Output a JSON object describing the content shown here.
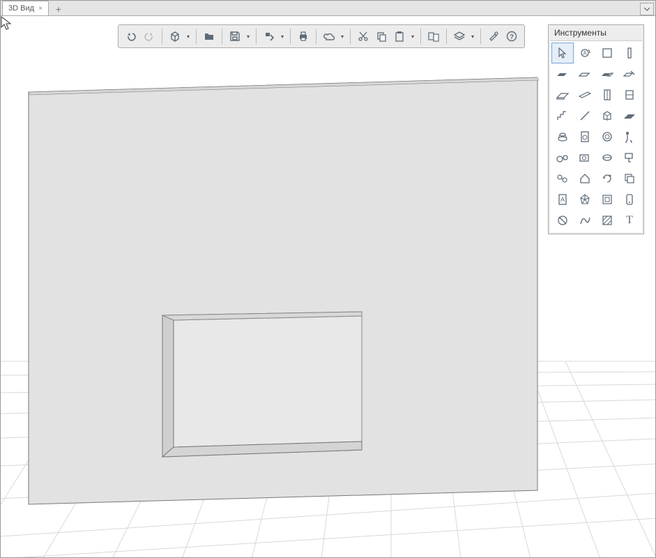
{
  "tab": {
    "label": "3D Вид"
  },
  "toolbar": {
    "undo": "undo",
    "redo": "redo",
    "box": "box",
    "open": "open",
    "save": "save",
    "export": "export",
    "print": "print",
    "cloud": "cloud",
    "cut": "cut",
    "copy": "copy",
    "paste": "paste",
    "pastegrp": "paste-special",
    "layers": "layers",
    "settings": "settings",
    "help": "help"
  },
  "panel": {
    "title": "Инструменты",
    "tools": [
      "select",
      "rotate-view",
      "plane",
      "column",
      "wall-1",
      "wall-2",
      "wall-3",
      "wall-edit",
      "slab",
      "beam",
      "door",
      "window",
      "stair-1",
      "line",
      "extrude-1",
      "extrude-2",
      "revolve",
      "appliance",
      "pipe",
      "sound",
      "wheels",
      "camera",
      "light",
      "paint",
      "group",
      "home",
      "sync",
      "stack",
      "material",
      "polyhedron",
      "library",
      "device",
      "dimension",
      "curve",
      "hatch",
      "text"
    ]
  },
  "text_tool_label": "T"
}
